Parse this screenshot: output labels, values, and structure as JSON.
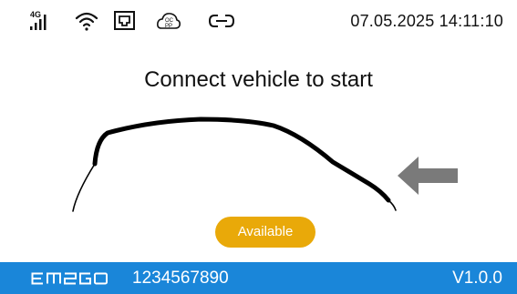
{
  "status_bar": {
    "network_label": "4G",
    "datetime": "07.05.2025 14:11:10",
    "ocpp_label_top": "OC",
    "ocpp_label_bottom": "PP",
    "icons": [
      "4g-signal-icon",
      "wifi-icon",
      "ethernet-icon",
      "ocpp-cloud-icon",
      "link-icon"
    ]
  },
  "main": {
    "instruction": "Connect vehicle to start",
    "status_badge": "Available"
  },
  "footer": {
    "logo_text": "EMEGO",
    "serial": "1234567890",
    "version": "V1.0.0"
  },
  "colors": {
    "accent_footer": "#1a86d9",
    "status_available": "#e9a909",
    "arrow": "#7a7a7a"
  }
}
